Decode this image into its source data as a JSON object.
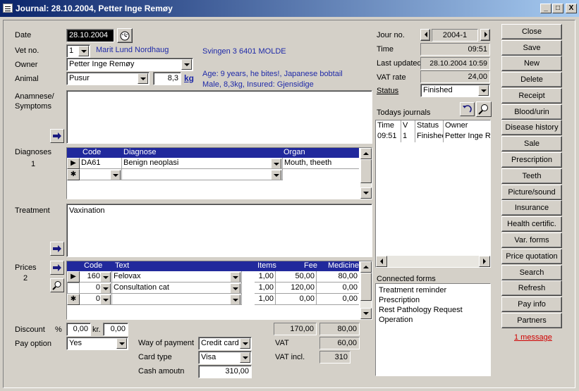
{
  "window": {
    "title": "Journal: 28.10.2004, Petter Inge Remøy",
    "min": "_",
    "max": "□",
    "close": "X"
  },
  "labels": {
    "date": "Date",
    "vet_no": "Vet no.",
    "owner": "Owner",
    "animal": "Animal",
    "anamnese": "Anamnese/\nSymptoms",
    "diagnoses": "Diagnoses",
    "diagnoses_count": "1",
    "treatment": "Treatment",
    "prices": "Prices",
    "prices_count": "2",
    "discount": "Discount",
    "percent": "%",
    "kr": "kr.",
    "pay_option": "Pay option",
    "way_of_payment": "Way of payment",
    "card_type": "Card type",
    "cash_amount": "Cash amoutn",
    "vat": "VAT",
    "vat_incl": "VAT incl.",
    "jour_no": "Jour no.",
    "time": "Time",
    "last_updated": "Last updated",
    "vat_rate": "VAT rate",
    "status": "Status",
    "todays_journals": "Todays journals",
    "connected_forms": "Connected forms"
  },
  "form": {
    "date": "28.10.2004",
    "vet_no": "1",
    "vet_name": "Marit Lund Nordhaug",
    "address": "Svingen 3 6401 MOLDE",
    "owner": "Petter Inge Remøy",
    "animal": "Pusur",
    "weight": "8,3",
    "weight_unit": "kg",
    "animal_info_1": "Age: 9 years, he bites!, Japanese bobtail",
    "animal_info_2": "Male, 8,3kg, Insured: Gjensidige",
    "anamnese": "",
    "treatment": "Vaxination",
    "discount_pct": "0,00",
    "discount_kr": "0,00",
    "pay_option": "Yes",
    "way_of_payment": "Credit card",
    "card_type": "Visa",
    "cash_amount": "310,00",
    "total_fee": "170,00",
    "total_medicine": "80,00",
    "vat": "60,00",
    "vat_incl": "310"
  },
  "diagnoses_grid": {
    "headers": [
      "Code",
      "Diagnose",
      "Organ"
    ],
    "rows": [
      {
        "code": "DA61",
        "diagnose": "Benign neoplasi",
        "organ": "Mouth, theeth"
      }
    ]
  },
  "prices_grid": {
    "headers": [
      "Code",
      "Text",
      "Items",
      "Fee",
      "Medicine"
    ],
    "rows": [
      {
        "code": "160",
        "text": "Felovax",
        "items": "1,00",
        "fee": "50,00",
        "medicine": "80,00"
      },
      {
        "code": "0",
        "text": "Consultation cat",
        "items": "1,00",
        "fee": "120,00",
        "medicine": "0,00"
      },
      {
        "code": "0",
        "text": "",
        "items": "1,00",
        "fee": "0,00",
        "medicine": "0,00"
      }
    ]
  },
  "journal": {
    "jour_no": "2004-1",
    "time": "09:51",
    "last_updated": "28.10.2004 10:59",
    "vat_rate": "24,00",
    "status": "Finished"
  },
  "todays_journals": {
    "headers": [
      "Time",
      "V",
      "Status",
      "Owner"
    ],
    "rows": [
      {
        "time": "09:51",
        "v": "1",
        "status": "Finished",
        "owner": "Petter Inge Remøy"
      }
    ]
  },
  "connected_forms": [
    "Treatment reminder",
    "Prescription",
    "Rest Pathology Request",
    "Operation"
  ],
  "buttons": [
    "Close",
    "Save",
    "New",
    "Delete",
    "Receipt",
    "Blood/urin",
    "Disease history",
    "Sale",
    "Prescription",
    "Teeth",
    "Picture/sound",
    "Insurance",
    "Health certific.",
    "Var. forms",
    "Price quotation",
    "Search",
    "Refresh",
    "Pay info",
    "Partners"
  ],
  "message_link": "1 message",
  "colors": {
    "title_start": "#0a246a",
    "title_end": "#a6caf0",
    "grid_header": "#21299c",
    "info_text": "#1f2aa8",
    "message": "#d00000"
  }
}
